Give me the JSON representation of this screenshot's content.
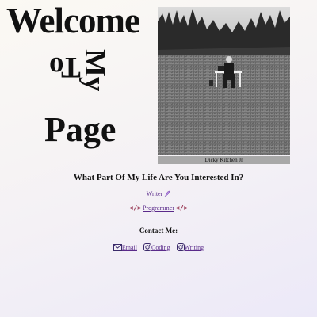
{
  "heading": {
    "welcome": "Welcome",
    "to": "To",
    "my": "My",
    "page": "Page"
  },
  "photo": {
    "caption": "Dicky Kitchen Jr"
  },
  "question": "What Part Of My Life Are You Interested In?",
  "links": {
    "writer": "Writer",
    "programmer": "Programmer"
  },
  "contact": {
    "title": "Contact Me:",
    "email": "Email",
    "coding": "Coding",
    "writing": "Writing"
  },
  "icons": {
    "writer": "quill-icon",
    "programmer": "code-brackets-icon",
    "email": "mail-icon",
    "coding": "instagram-icon",
    "writing": "instagram-icon"
  }
}
